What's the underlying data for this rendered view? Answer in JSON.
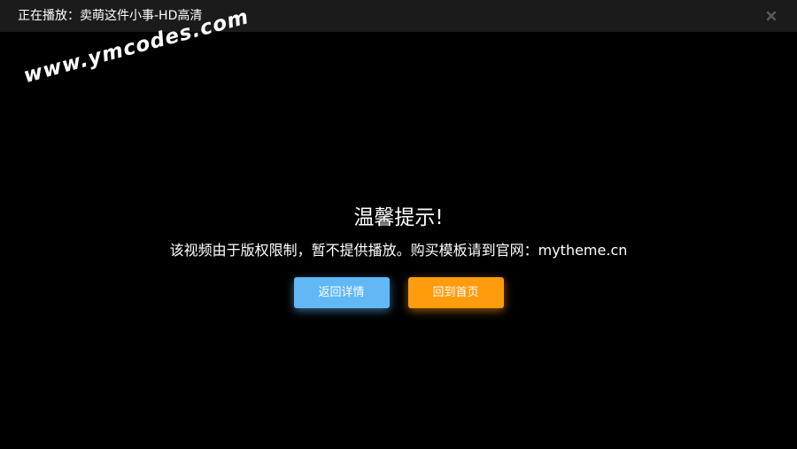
{
  "titlebar": {
    "now_playing": "正在播放：卖萌这件小事-HD高清",
    "close_icon": "close-icon"
  },
  "watermark": {
    "text": "www.ymcodes.com"
  },
  "notice": {
    "title": "温馨提示!",
    "message": "该视频由于版权限制，暂不提供播放。购买模板请到官网：mytheme.cn"
  },
  "actions": {
    "back_label": "返回详情",
    "home_label": "回到首页"
  },
  "colors": {
    "background": "#000000",
    "titlebar": "#1b1b1b",
    "back_button": "#62b8f5",
    "home_button": "#ff9c0d"
  }
}
